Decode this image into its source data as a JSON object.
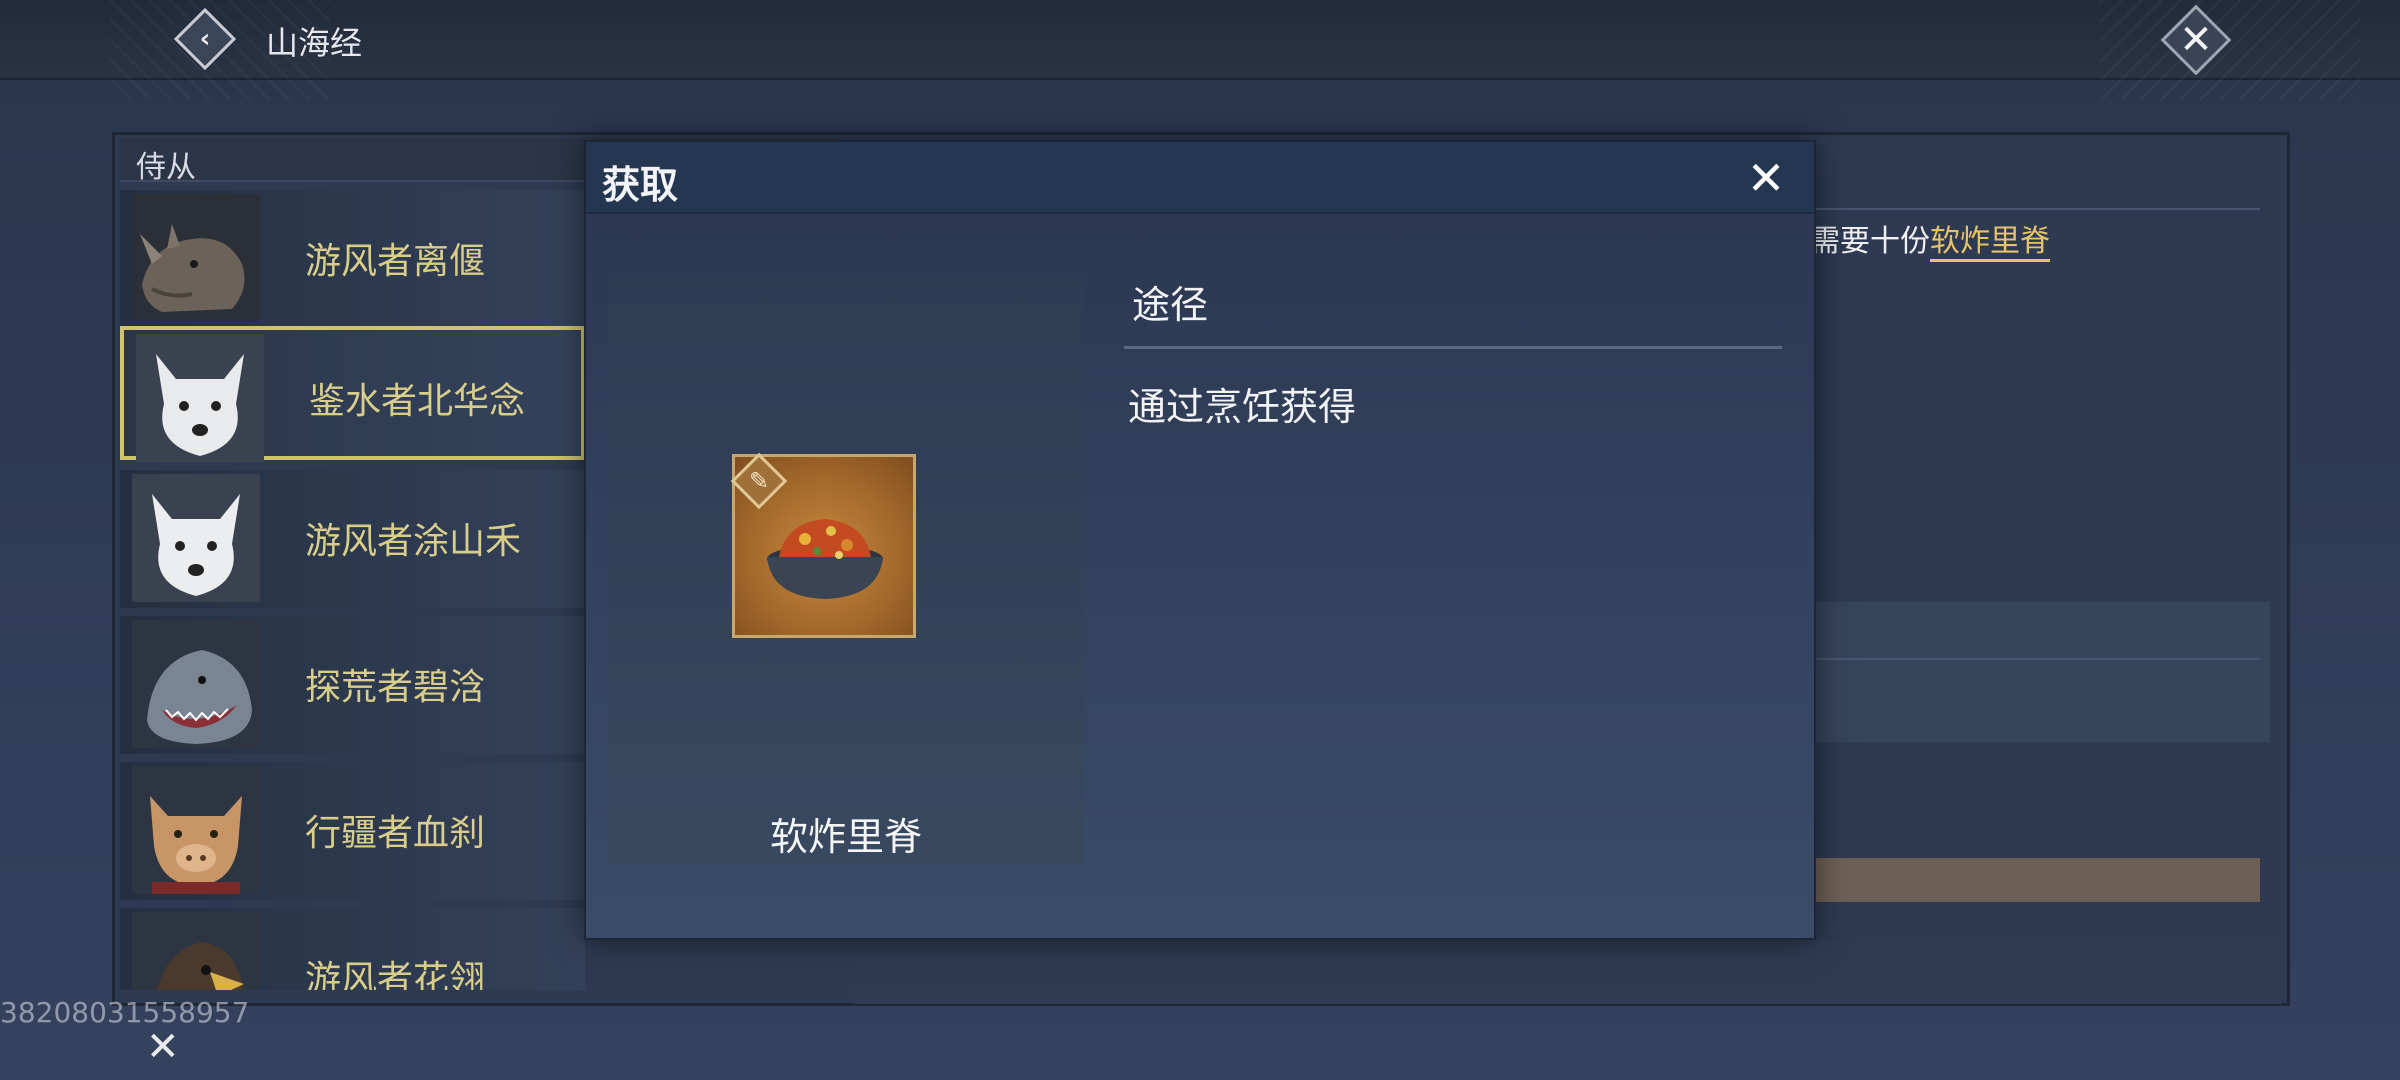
{
  "header": {
    "title": "山海经",
    "back_icon": "chevron-left-icon",
    "close_icon": "close-icon"
  },
  "companions": {
    "header": "侍从",
    "items": [
      {
        "name": "游风者离偃",
        "portrait": "rhino-portrait",
        "selected": false
      },
      {
        "name": "鉴水者北华念",
        "portrait": "arctic-fox-portrait",
        "selected": true
      },
      {
        "name": "游风者涂山禾",
        "portrait": "arctic-fox-portrait",
        "selected": false
      },
      {
        "name": "探荒者碧浛",
        "portrait": "shark-portrait",
        "selected": false
      },
      {
        "name": "行疆者血刹",
        "portrait": "boar-portrait",
        "selected": false
      },
      {
        "name": "游风者花翎",
        "portrait": "eagle-portrait",
        "selected": false
      }
    ]
  },
  "right_panel": {
    "need_prefix": "需要十份",
    "need_item": "软炸里脊"
  },
  "uid": "38208031558957",
  "dialog": {
    "title": "获取",
    "item_name": "软炸里脊",
    "item_icon": "fried-tenderloin-bowl-icon",
    "source_title": "途径",
    "sources": [
      "通过烹饪获得"
    ]
  },
  "colors": {
    "highlight": "#e6c269",
    "selected_border": "#cfc270",
    "companion_name": "#d8cd8a"
  }
}
